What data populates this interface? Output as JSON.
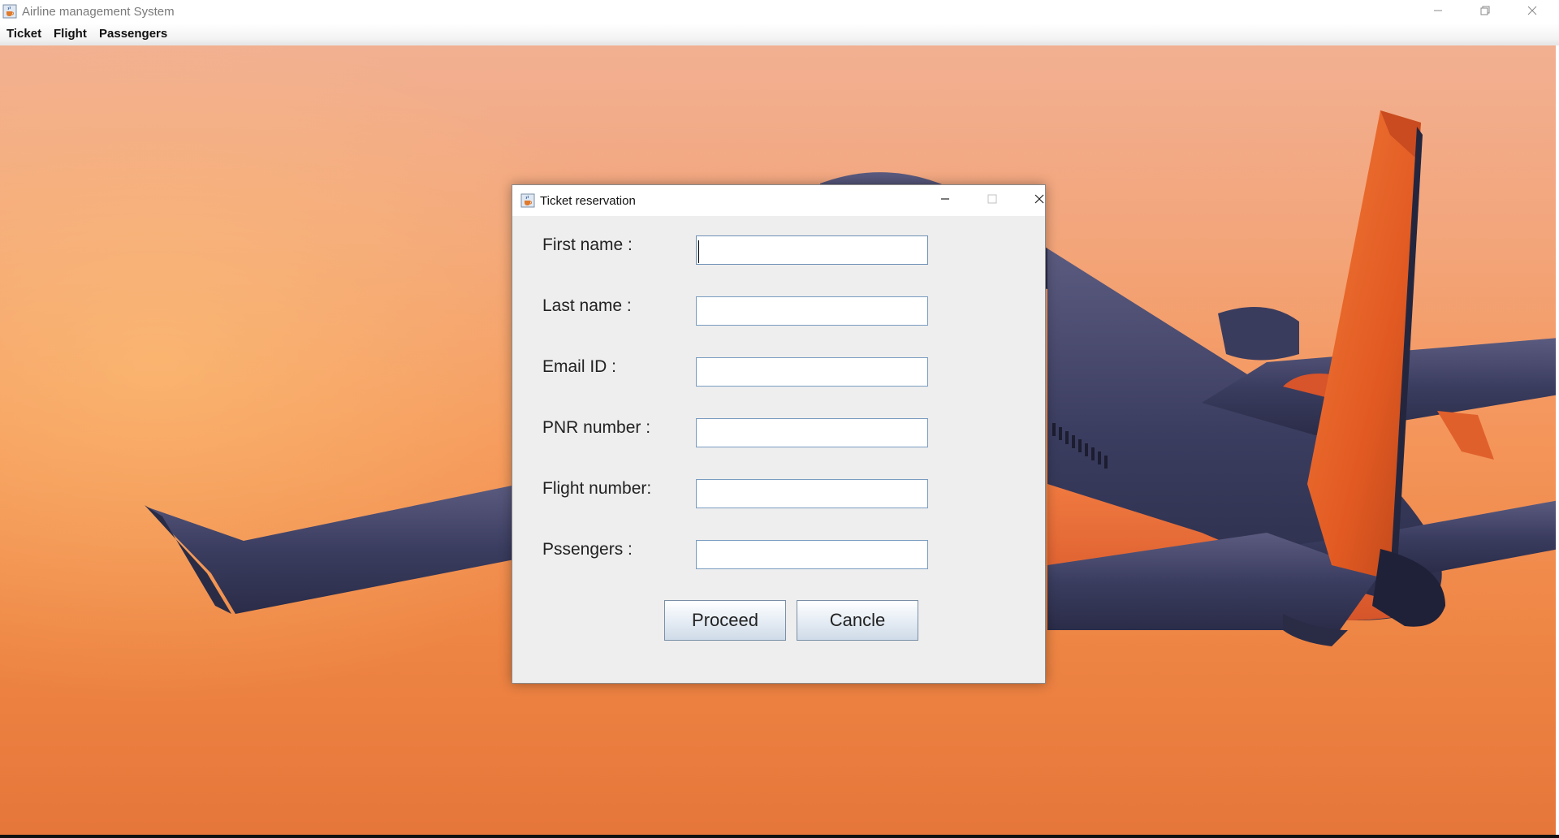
{
  "window": {
    "title": "Airline management System"
  },
  "menu": {
    "items": [
      "Ticket",
      "Flight",
      "Passengers"
    ]
  },
  "dialog": {
    "title": "Ticket reservation",
    "fields": [
      {
        "label": "First name :",
        "value": ""
      },
      {
        "label": "Last name :",
        "value": ""
      },
      {
        "label": "Email ID :",
        "value": ""
      },
      {
        "label": "PNR number :",
        "value": ""
      },
      {
        "label": "Flight number:",
        "value": ""
      },
      {
        "label": "Pssengers :",
        "value": ""
      }
    ],
    "buttons": {
      "proceed": "Proceed",
      "cancel": "Cancle"
    }
  },
  "colors": {
    "sky_top": "#f2b092",
    "sky_bottom": "#e6763a",
    "plane_body": "#3d3f63",
    "plane_tail": "#ec6a2e",
    "dialog_bg": "#eeeeee",
    "button_border": "#7a8fa6"
  },
  "icons": {
    "app": "java-cup-icon",
    "minimize": "minimize-icon",
    "maximize": "restore-icon",
    "close": "close-icon"
  }
}
